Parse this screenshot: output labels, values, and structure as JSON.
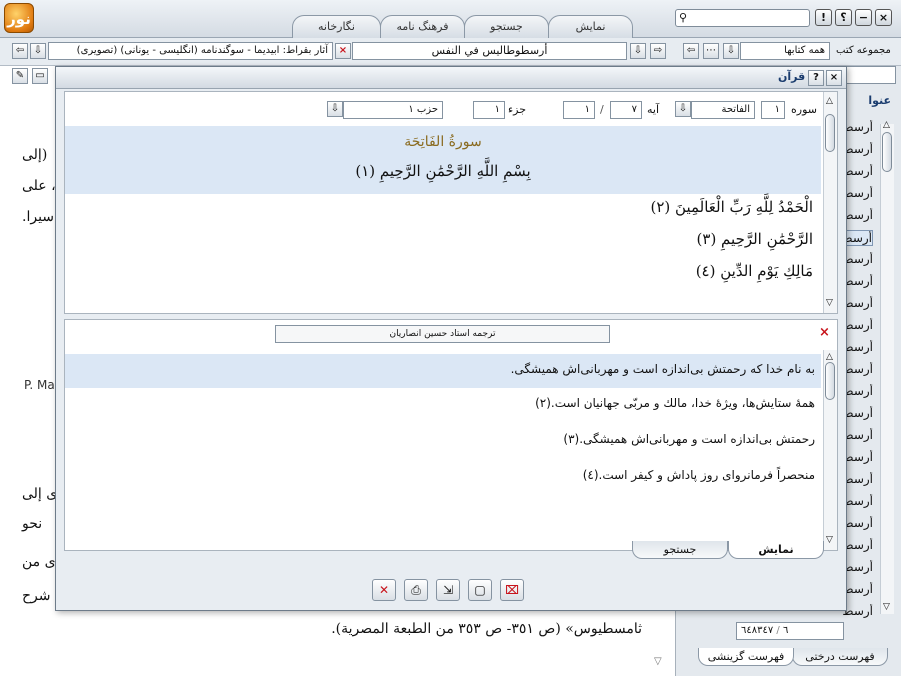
{
  "app": {
    "logo_glyph": "نور"
  },
  "tabs": [
    {
      "label": "نمایش",
      "active": true
    },
    {
      "label": "جستجو",
      "active": false
    },
    {
      "label": "فرهنگ نامه",
      "active": false
    },
    {
      "label": "نگارخانه",
      "active": false
    }
  ],
  "window_buttons": {
    "close": "×",
    "min": "−",
    "help": "؟",
    "info": "!"
  },
  "toolbar": {
    "book_title": "أرسطوطاليس في النفس",
    "series_title": "آثار بقراط: ابيديما - سوگندنامه (انگليسى - يونانى) (تصويرى)",
    "collection_label": "مجموعه كتب",
    "collection_value": "همه كتابها"
  },
  "doc": {
    "lines": [
      "(إلى",
      "، على",
      "سيرا.",
      "P. Ma",
      "ى إلى",
      "نحو",
      "ى من",
      "شرح"
    ],
    "bottom_line": "ثامسطيوس» (ص ٣٥١- ص ٣٥٣ من الطبعة المصرية)."
  },
  "right_panel": {
    "header": "عنوا",
    "items": [
      "أرسط",
      "أرسط",
      "أرسط",
      "أرسط",
      "أرسط",
      "أرسط",
      "أرسط",
      "أرسط",
      "أرسط",
      "أرسط",
      "أرسط",
      "أرسط",
      "أرسط",
      "أرسط",
      "أرسط",
      "أرسط",
      "أرسط",
      "أرسط",
      "أرسط",
      "أرسط",
      "أرسط",
      "أرسط",
      "أرسط"
    ],
    "selected_index": 5,
    "page_total": "٦٤٨٣٤٧",
    "page_current": "٦",
    "tabs": [
      "فهرست درختى",
      "فهرست گزينشى"
    ]
  },
  "dialog": {
    "title": "قرآن",
    "surah_label": "سوره",
    "surah_number": "١",
    "surah_name": "الفاتحة",
    "ayah_label": "آيه",
    "ayah_value": "٧",
    "ayah_sep": "/",
    "ayah_current": "١",
    "juz_label": "جزء",
    "juz_value": "١",
    "hizb_value": "حزب ١",
    "surah_heading": "سورةُ الفَاتِحَة",
    "verses": [
      "بِسْمِ اللَّهِ الرَّحْمَٰنِ الرَّحِيمِ (١)",
      "الْحَمْدُ لِلَّهِ رَبِّ الْعَالَمِينَ (٢)",
      "الرَّحْمَٰنِ الرَّحِيمِ (٣)",
      "مَالِكِ يَوْمِ الدِّينِ (٤)"
    ],
    "translator": "ترجمه استاد حسین انصاریان",
    "translation": [
      "به نام خدا كه رحمتش بى‌اندازه است و مهربانى‌اش هميشگى.",
      "همهٔ ستايش‌ها، ويژهٔ خدا، مالك و مربّى جهانيان است.(٢)",
      "رحمتش بى‌اندازه است و مهربانى‌اش هميشگى.(٣)",
      "منحصراً فرمانرواى روز پاداش و كيفر است.(٤)"
    ],
    "inner_tabs": [
      "نمایش",
      "جستجو"
    ]
  }
}
